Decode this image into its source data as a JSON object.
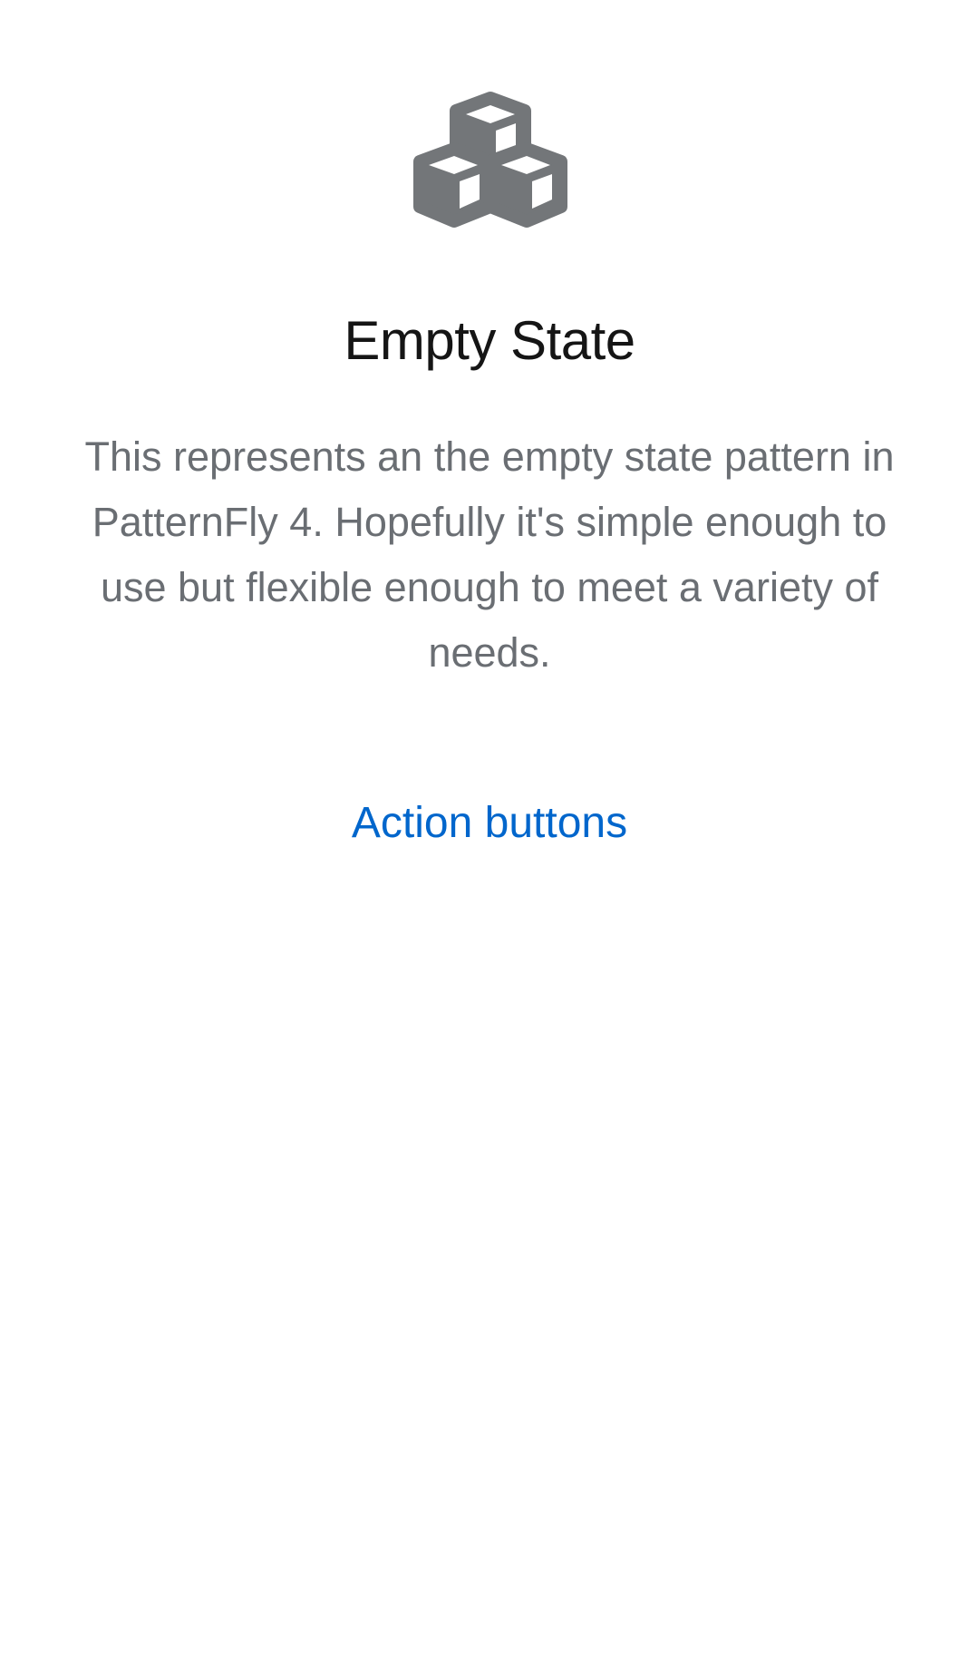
{
  "empty_state": {
    "icon": "cubes-icon",
    "icon_color": "#737679",
    "title": "Empty State",
    "body": "This represents an the empty state pattern in PatternFly 4. Hopefully it's simple enough to use but flexible enough to meet a variety of needs.",
    "action_label": "Action buttons",
    "action_color": "#0066cc"
  }
}
